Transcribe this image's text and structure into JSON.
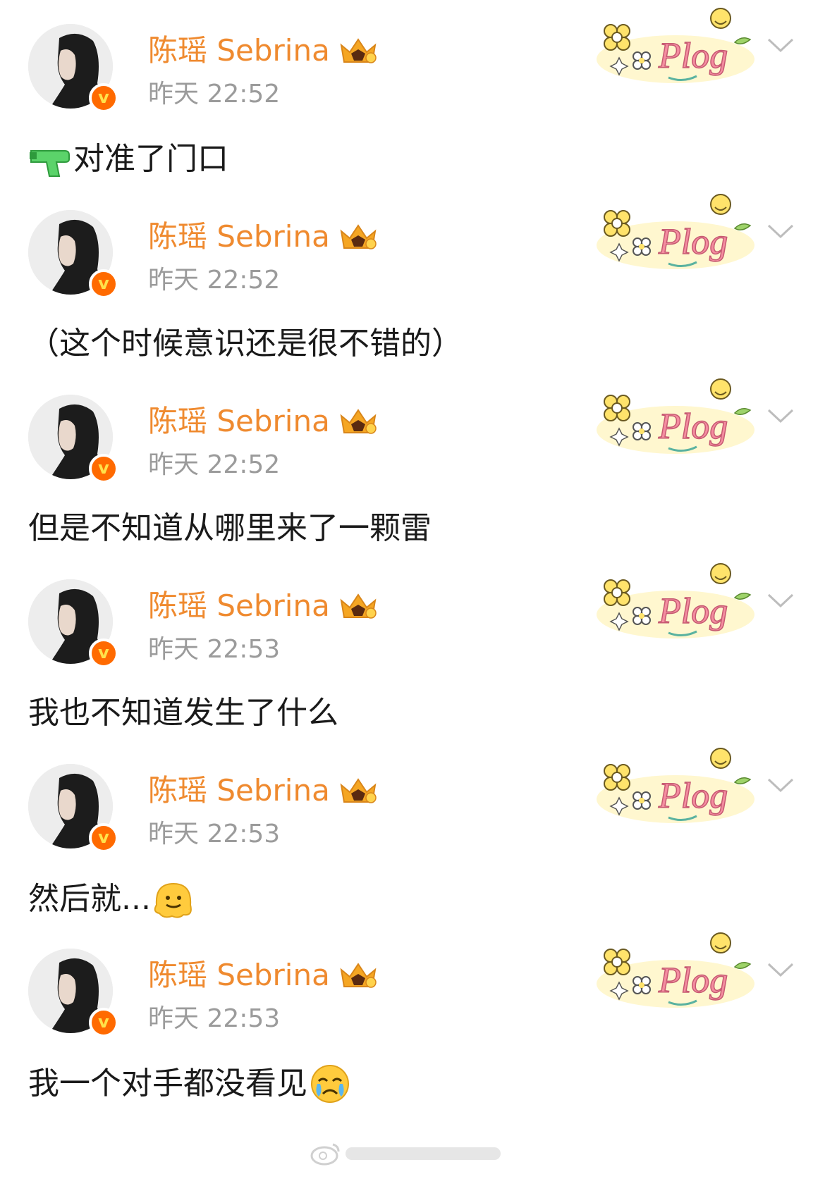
{
  "colors": {
    "username": "#ef8a2f",
    "timestamp": "#9b9b9b",
    "verified_badge": "#ff6a00",
    "text": "#1a1a1a"
  },
  "badges": {
    "verified_letter": "v",
    "plog_sticker_text": "Plog"
  },
  "posts": [
    {
      "username": "陈瑶 Sebrina",
      "timestamp": "昨天 22:52",
      "text": "对准了门口",
      "emoji_before": "water-pistol-icon"
    },
    {
      "username": "陈瑶 Sebrina",
      "timestamp": "昨天 22:52",
      "text": "（这个时候意识还是很不错的）"
    },
    {
      "username": "陈瑶 Sebrina",
      "timestamp": "昨天 22:52",
      "text": "但是不知道从哪里来了一颗雷"
    },
    {
      "username": "陈瑶 Sebrina",
      "timestamp": "昨天 22:53",
      "text": "我也不知道发生了什么"
    },
    {
      "username": "陈瑶 Sebrina",
      "timestamp": "昨天 22:53",
      "text": "然后就...",
      "emoji_after": "melting-face-icon"
    },
    {
      "username": "陈瑶 Sebrina",
      "timestamp": "昨天 22:53",
      "text": "我一个对手都没看见",
      "emoji_after": "crying-face-icon"
    }
  ]
}
